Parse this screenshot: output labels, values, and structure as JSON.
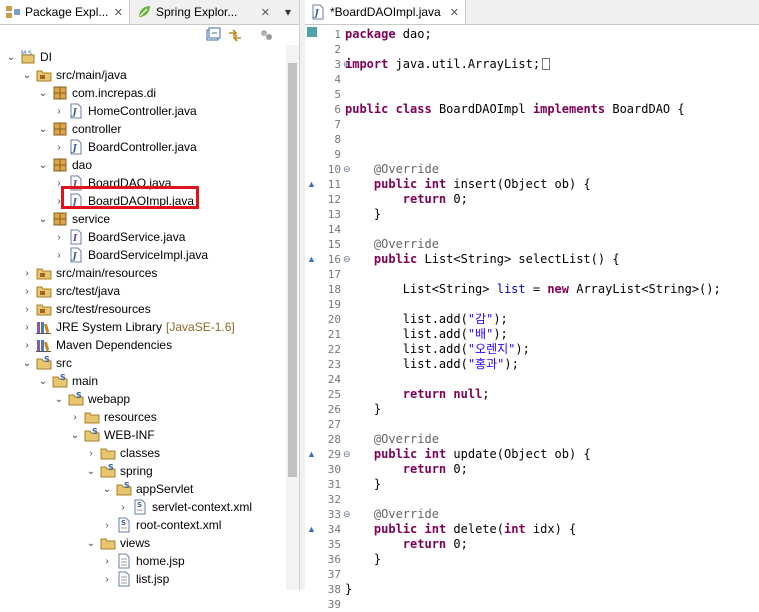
{
  "left_view": {
    "tabs": [
      {
        "label": "Package Expl...",
        "close": "✕",
        "icon": "package-explorer-icon"
      },
      {
        "label": "Spring Explor...",
        "close": "✕",
        "icon": "spring-explorer-icon"
      }
    ],
    "view_menu": "▾",
    "tree": [
      {
        "label": "DI",
        "icon": "maven-project-icon",
        "expanded": true
      },
      {
        "label": "src/main/java",
        "icon": "source-folder-icon",
        "expanded": true
      },
      {
        "label": "com.increpas.di",
        "icon": "package-icon",
        "expanded": true
      },
      {
        "label": "HomeController.java",
        "icon": "java-file-icon",
        "expanded": false
      },
      {
        "label": "controller",
        "icon": "package-icon",
        "expanded": true
      },
      {
        "label": "BoardController.java",
        "icon": "java-file-icon",
        "expanded": false
      },
      {
        "label": "dao",
        "icon": "package-icon",
        "expanded": true
      },
      {
        "label": "BoardDAO.java",
        "icon": "java-interface-file-icon",
        "expanded": false
      },
      {
        "label": "BoardDAOImpl.java",
        "icon": "java-file-icon",
        "expanded": false,
        "selected": true
      },
      {
        "label": "service",
        "icon": "package-icon",
        "expanded": true
      },
      {
        "label": "BoardService.java",
        "icon": "java-interface-file-icon",
        "expanded": false
      },
      {
        "label": "BoardServiceImpl.java",
        "icon": "java-file-icon",
        "expanded": false
      },
      {
        "label": "src/main/resources",
        "icon": "source-folder-icon",
        "expanded": false
      },
      {
        "label": "src/test/java",
        "icon": "source-folder-icon",
        "expanded": false
      },
      {
        "label": "src/test/resources",
        "icon": "source-folder-icon",
        "expanded": false
      },
      {
        "label": "JRE System Library",
        "decoration": "[JavaSE-1.6]",
        "icon": "library-icon",
        "expanded": false
      },
      {
        "label": "Maven Dependencies",
        "icon": "library-icon",
        "expanded": false
      },
      {
        "label": "src",
        "icon": "spring-folder-icon",
        "expanded": true
      },
      {
        "label": "main",
        "icon": "spring-folder-icon",
        "expanded": true
      },
      {
        "label": "webapp",
        "icon": "spring-folder-icon",
        "expanded": true
      },
      {
        "label": "resources",
        "icon": "folder-icon",
        "expanded": false
      },
      {
        "label": "WEB-INF",
        "icon": "spring-folder-icon",
        "expanded": true
      },
      {
        "label": "classes",
        "icon": "folder-icon",
        "expanded": false
      },
      {
        "label": "spring",
        "icon": "spring-folder-icon",
        "expanded": true
      },
      {
        "label": "appServlet",
        "icon": "spring-folder-icon",
        "expanded": true
      },
      {
        "label": "servlet-context.xml",
        "icon": "spring-xml-file-icon",
        "expanded": false
      },
      {
        "label": "root-context.xml",
        "icon": "spring-xml-file-icon",
        "expanded": false
      },
      {
        "label": "views",
        "icon": "folder-icon",
        "expanded": true
      },
      {
        "label": "home.jsp",
        "icon": "jsp-file-icon",
        "expanded": false
      },
      {
        "label": "list.jsp",
        "icon": "jsp-file-icon",
        "expanded": false
      }
    ]
  },
  "editor": {
    "tab_label": "*BoardDAOImpl.java",
    "tab_close": "✕",
    "lines": [
      {
        "n": "1",
        "t": [
          {
            "k": "kw",
            "s": "package"
          },
          {
            "k": "",
            "s": " dao;"
          }
        ]
      },
      {
        "n": "2",
        "t": []
      },
      {
        "n": "3",
        "t": [
          {
            "k": "kw",
            "s": "import"
          },
          {
            "k": "",
            "s": " java.util.ArrayList;"
          },
          {
            "k": "box",
            "s": ""
          }
        ],
        "fold": "⊕"
      },
      {
        "n": "4",
        "t": []
      },
      {
        "n": "5",
        "t": []
      },
      {
        "n": "6",
        "t": [
          {
            "k": "kw",
            "s": "public"
          },
          {
            "k": "",
            "s": " "
          },
          {
            "k": "kw",
            "s": "class"
          },
          {
            "k": "",
            "s": " BoardDAOImpl "
          },
          {
            "k": "kw",
            "s": "implements"
          },
          {
            "k": "",
            "s": " BoardDAO {"
          }
        ]
      },
      {
        "n": "7",
        "t": []
      },
      {
        "n": "8",
        "t": []
      },
      {
        "n": "9",
        "t": []
      },
      {
        "n": "10",
        "t": [
          {
            "k": "",
            "s": "    "
          },
          {
            "k": "ann",
            "s": "@Override"
          }
        ],
        "fold": "⊖"
      },
      {
        "n": "11",
        "t": [
          {
            "k": "",
            "s": "    "
          },
          {
            "k": "kw",
            "s": "public"
          },
          {
            "k": "",
            "s": " "
          },
          {
            "k": "kw",
            "s": "int"
          },
          {
            "k": "",
            "s": " insert(Object ob) {"
          }
        ],
        "marker": "▲"
      },
      {
        "n": "12",
        "t": [
          {
            "k": "",
            "s": "        "
          },
          {
            "k": "kw",
            "s": "return"
          },
          {
            "k": "",
            "s": " 0;"
          }
        ]
      },
      {
        "n": "13",
        "t": [
          {
            "k": "",
            "s": "    }"
          }
        ]
      },
      {
        "n": "14",
        "t": []
      },
      {
        "n": "15",
        "t": [
          {
            "k": "",
            "s": "    "
          },
          {
            "k": "ann",
            "s": "@Override"
          }
        ]
      },
      {
        "n": "16",
        "t": [
          {
            "k": "",
            "s": "    "
          },
          {
            "k": "kw",
            "s": "public"
          },
          {
            "k": "",
            "s": " List<String> selectList() {"
          }
        ],
        "fold": "⊖",
        "marker": "▲"
      },
      {
        "n": "17",
        "t": []
      },
      {
        "n": "18",
        "t": [
          {
            "k": "",
            "s": "        List<String> "
          },
          {
            "k": "fld",
            "s": "list"
          },
          {
            "k": "",
            "s": " = "
          },
          {
            "k": "kw",
            "s": "new"
          },
          {
            "k": "",
            "s": " ArrayList<String>();"
          }
        ]
      },
      {
        "n": "19",
        "t": []
      },
      {
        "n": "20",
        "t": [
          {
            "k": "",
            "s": "        list.add("
          },
          {
            "k": "str",
            "s": "\"감\""
          },
          {
            "k": "",
            "s": ");"
          }
        ]
      },
      {
        "n": "21",
        "t": [
          {
            "k": "",
            "s": "        list.add("
          },
          {
            "k": "str",
            "s": "\"배\""
          },
          {
            "k": "",
            "s": ");"
          }
        ]
      },
      {
        "n": "22",
        "t": [
          {
            "k": "",
            "s": "        list.add("
          },
          {
            "k": "str",
            "s": "\"오렌지\""
          },
          {
            "k": "",
            "s": ");"
          }
        ]
      },
      {
        "n": "23",
        "t": [
          {
            "k": "",
            "s": "        list.add("
          },
          {
            "k": "str",
            "s": "\"홍과\""
          },
          {
            "k": "",
            "s": ");"
          }
        ]
      },
      {
        "n": "24",
        "t": []
      },
      {
        "n": "25",
        "t": [
          {
            "k": "",
            "s": "        "
          },
          {
            "k": "kw",
            "s": "return"
          },
          {
            "k": "",
            "s": " "
          },
          {
            "k": "kw",
            "s": "null"
          },
          {
            "k": "",
            "s": ";"
          }
        ]
      },
      {
        "n": "26",
        "t": [
          {
            "k": "",
            "s": "    }"
          }
        ]
      },
      {
        "n": "27",
        "t": []
      },
      {
        "n": "28",
        "t": [
          {
            "k": "",
            "s": "    "
          },
          {
            "k": "ann",
            "s": "@Override"
          }
        ]
      },
      {
        "n": "29",
        "t": [
          {
            "k": "",
            "s": "    "
          },
          {
            "k": "kw",
            "s": "public"
          },
          {
            "k": "",
            "s": " "
          },
          {
            "k": "kw",
            "s": "int"
          },
          {
            "k": "",
            "s": " update(Object ob) {"
          }
        ],
        "fold": "⊖",
        "marker": "▲"
      },
      {
        "n": "30",
        "t": [
          {
            "k": "",
            "s": "        "
          },
          {
            "k": "kw",
            "s": "return"
          },
          {
            "k": "",
            "s": " 0;"
          }
        ]
      },
      {
        "n": "31",
        "t": [
          {
            "k": "",
            "s": "    }"
          }
        ]
      },
      {
        "n": "32",
        "t": []
      },
      {
        "n": "33",
        "t": [
          {
            "k": "",
            "s": "    "
          },
          {
            "k": "ann",
            "s": "@Override"
          }
        ],
        "fold": "⊖"
      },
      {
        "n": "34",
        "t": [
          {
            "k": "",
            "s": "    "
          },
          {
            "k": "kw",
            "s": "public"
          },
          {
            "k": "",
            "s": " "
          },
          {
            "k": "kw",
            "s": "int"
          },
          {
            "k": "",
            "s": " delete("
          },
          {
            "k": "kw",
            "s": "int"
          },
          {
            "k": "",
            "s": " idx) {"
          }
        ],
        "marker": "▲"
      },
      {
        "n": "35",
        "t": [
          {
            "k": "",
            "s": "        "
          },
          {
            "k": "kw",
            "s": "return"
          },
          {
            "k": "",
            "s": " 0;"
          }
        ]
      },
      {
        "n": "36",
        "t": [
          {
            "k": "",
            "s": "    }"
          }
        ]
      },
      {
        "n": "37",
        "t": []
      },
      {
        "n": "38",
        "t": [
          {
            "k": "",
            "s": "}"
          }
        ]
      },
      {
        "n": "39",
        "t": []
      }
    ]
  },
  "colors": {
    "keyword": "#7f0055",
    "annotation": "#646464",
    "string": "#2a00ff",
    "field": "#0000c0",
    "selection_highlight": "#e0121c"
  }
}
